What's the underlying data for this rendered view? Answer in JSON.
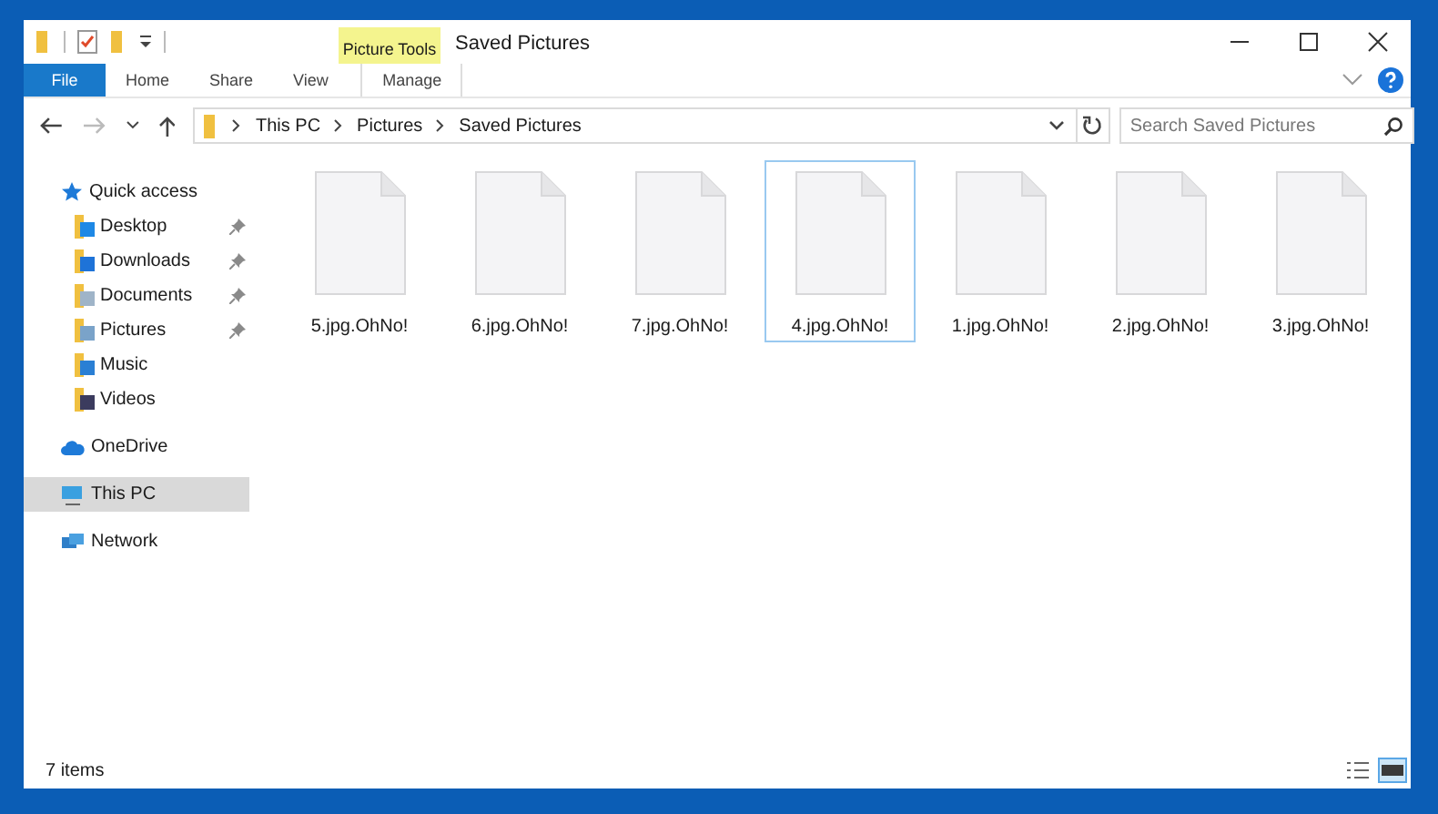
{
  "window": {
    "title": "Saved Pictures",
    "context_group": "Picture Tools"
  },
  "ribbon_tabs": [
    {
      "label": "File",
      "kind": "file"
    },
    {
      "label": "Home",
      "kind": "tab"
    },
    {
      "label": "Share",
      "kind": "tab"
    },
    {
      "label": "View",
      "kind": "tab"
    },
    {
      "label": "Manage",
      "kind": "context"
    }
  ],
  "address_bar": {
    "crumbs": [
      "This PC",
      "Pictures",
      "Saved Pictures"
    ]
  },
  "search": {
    "placeholder": "Search Saved Pictures"
  },
  "sidebar": [
    {
      "label": "Quick access",
      "kind": "star",
      "selected": false,
      "children": [
        {
          "label": "Desktop",
          "kind": "desktop",
          "pinned": true,
          "selected": false
        },
        {
          "label": "Downloads",
          "kind": "downloads",
          "pinned": true,
          "selected": false
        },
        {
          "label": "Documents",
          "kind": "documents",
          "pinned": true,
          "selected": false
        },
        {
          "label": "Pictures",
          "kind": "pictures",
          "pinned": true,
          "selected": false
        },
        {
          "label": "Music",
          "kind": "music",
          "pinned": false,
          "selected": false
        },
        {
          "label": "Videos",
          "kind": "videos",
          "pinned": false,
          "selected": false
        }
      ]
    },
    {
      "label": "OneDrive",
      "kind": "cloud",
      "selected": false
    },
    {
      "label": "This PC",
      "kind": "pc",
      "selected": true
    },
    {
      "label": "Network",
      "kind": "network",
      "selected": false
    }
  ],
  "files": [
    {
      "name": "5.jpg.OhNo!",
      "selected": false
    },
    {
      "name": "6.jpg.OhNo!",
      "selected": false
    },
    {
      "name": "7.jpg.OhNo!",
      "selected": false
    },
    {
      "name": "4.jpg.OhNo!",
      "selected": true
    },
    {
      "name": "1.jpg.OhNo!",
      "selected": false
    },
    {
      "name": "2.jpg.OhNo!",
      "selected": false
    },
    {
      "name": "3.jpg.OhNo!",
      "selected": false
    }
  ],
  "status_bar": {
    "count": "7 items",
    "views": [
      {
        "kind": "details",
        "selected": false
      },
      {
        "kind": "large-icons",
        "selected": true
      }
    ]
  }
}
